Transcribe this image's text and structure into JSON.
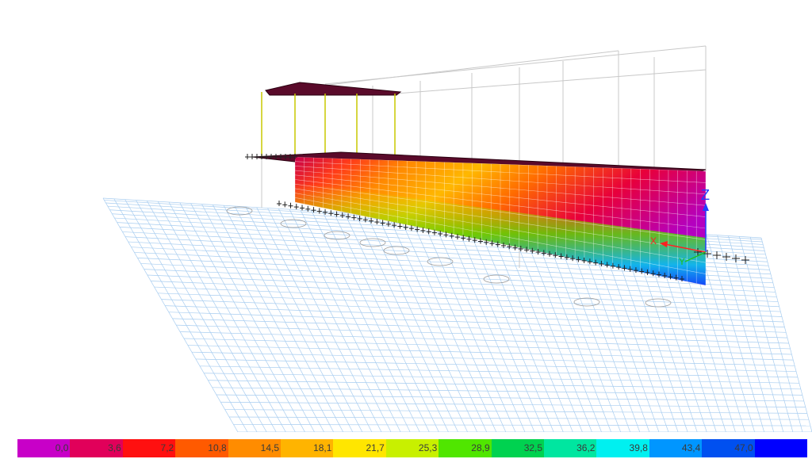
{
  "legend": {
    "colors": [
      "#c800c8",
      "#e1005a",
      "#ff1010",
      "#ff5a00",
      "#ff8c00",
      "#ffb400",
      "#ffe600",
      "#c8f000",
      "#50e600",
      "#00d250",
      "#00e6a0",
      "#00f0f0",
      "#0096ff",
      "#0050f0",
      "#0000ff"
    ],
    "labels": [
      "0,0",
      "3,6",
      "7,2",
      "10,8",
      "14,5",
      "18,1",
      "21,7",
      "25,3",
      "28,9",
      "32,5",
      "36,2",
      "39,8",
      "43,4",
      "47,0",
      ""
    ]
  },
  "axes": {
    "z_label": "Z",
    "x_label": "X",
    "y_label": "Y"
  },
  "gridlines": {
    "bubble_count": 9
  }
}
